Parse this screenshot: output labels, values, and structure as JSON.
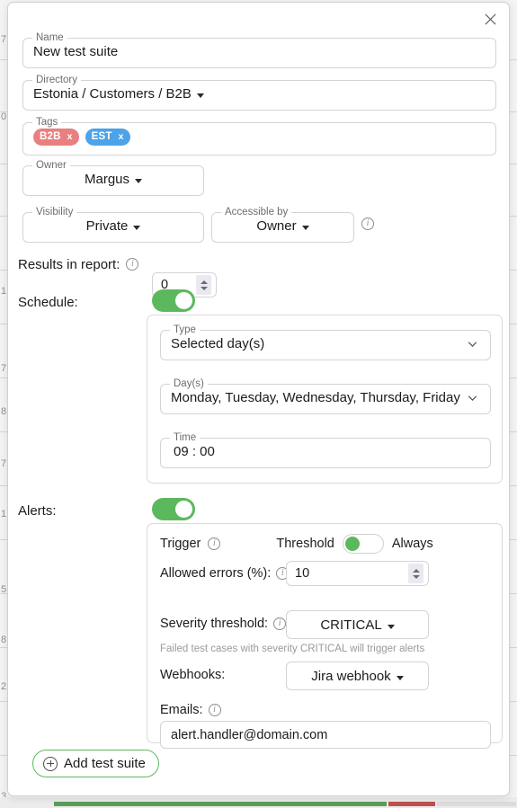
{
  "window": {
    "close_icon": "close-icon"
  },
  "colors": {
    "toggle_on": "#5cb85c",
    "tag_b2b": "#e8807f",
    "tag_est": "#4da3e8",
    "accent_button_border": "#5cb85c"
  },
  "form": {
    "name": {
      "label": "Name",
      "value": "New test suite"
    },
    "directory": {
      "label": "Directory",
      "value": "Estonia / Customers / B2B"
    },
    "tags": {
      "label": "Tags",
      "items": [
        {
          "text": "B2B",
          "color": "#e8807f",
          "remove_label": "x"
        },
        {
          "text": "EST",
          "color": "#4da3e8",
          "remove_label": "x"
        }
      ]
    },
    "owner": {
      "label": "Owner",
      "value": "Margus"
    },
    "visibility": {
      "label": "Visibility",
      "value": "Private"
    },
    "accessible_by": {
      "label": "Accessible by",
      "value": "Owner"
    },
    "results_in_report": {
      "label": "Results in report:",
      "value": "0"
    },
    "schedule": {
      "label": "Schedule:",
      "enabled": "true",
      "type": {
        "label": "Type",
        "value": "Selected day(s)"
      },
      "days": {
        "label": "Day(s)",
        "value": "Monday, Tuesday, Wednesday, Thursday, Friday"
      },
      "time": {
        "label": "Time",
        "value": "09 : 00"
      }
    },
    "alerts": {
      "label": "Alerts:",
      "enabled": "true",
      "trigger_label": "Trigger",
      "threshold_label": "Threshold",
      "threshold_state": "Always",
      "allowed_errors": {
        "label": "Allowed errors (%):",
        "value": "10"
      },
      "severity_threshold": {
        "label": "Severity threshold:",
        "value": "CRITICAL"
      },
      "severity_hint": "Failed test cases with severity CRITICAL will trigger alerts",
      "webhooks": {
        "label": "Webhooks:",
        "value": "Jira webhook"
      },
      "emails": {
        "label": "Emails:",
        "value": "alert.handler@domain.com"
      }
    },
    "add_test_suite": "Add test suite"
  },
  "backdrop": {
    "row_numbers": [
      "7",
      "0",
      "1",
      "7",
      "8",
      "7",
      "1",
      "5",
      "8",
      "2",
      "3"
    ]
  }
}
